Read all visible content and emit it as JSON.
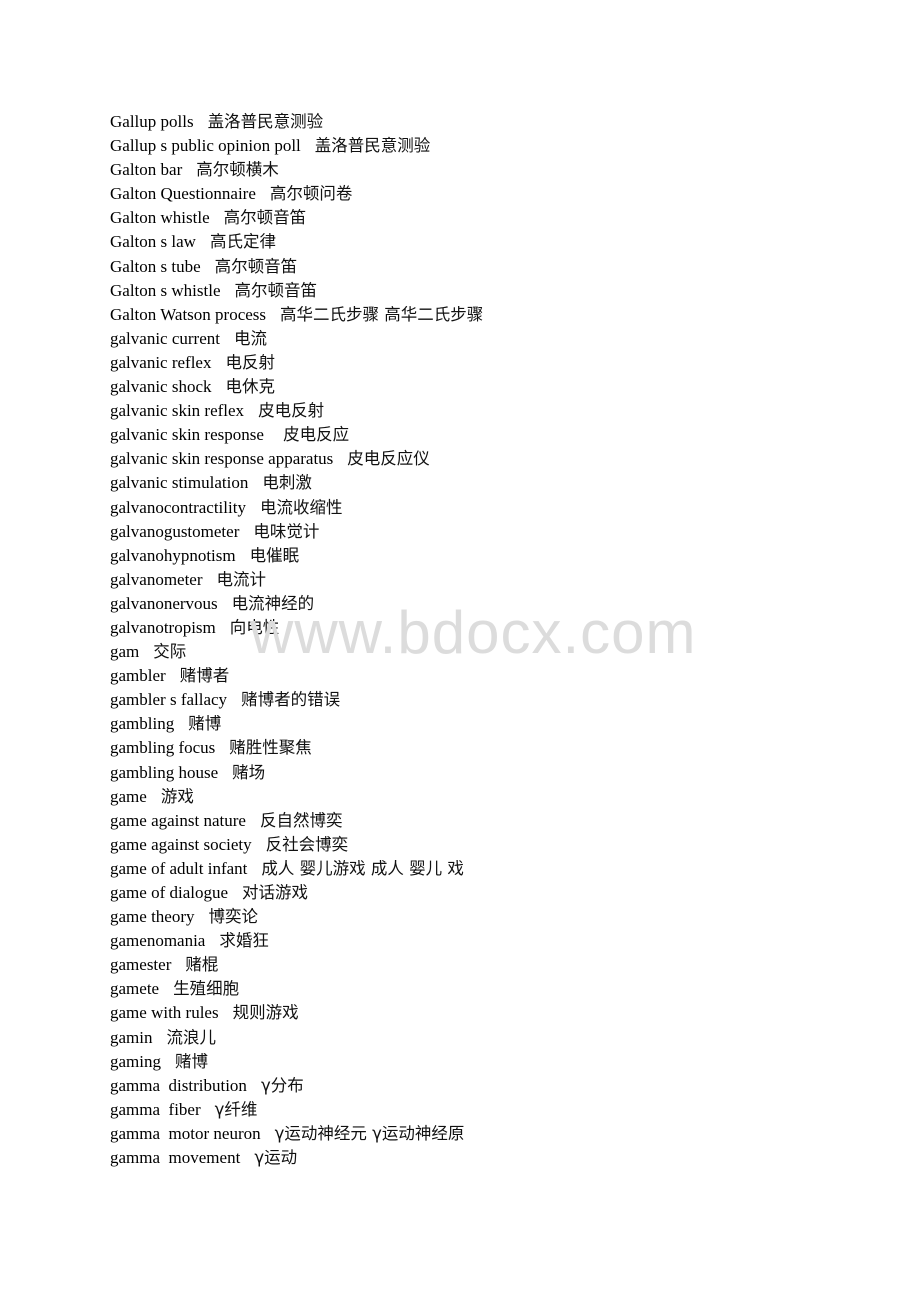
{
  "watermark": "www.bdocx.com",
  "entries": [
    {
      "term": "Gallup polls",
      "translation": "盖洛普民意测验"
    },
    {
      "term": "Gallup s public opinion poll",
      "translation": "盖洛普民意测验"
    },
    {
      "term": "Galton bar",
      "translation": "高尔顿横木"
    },
    {
      "term": "Galton Questionnaire",
      "translation": "高尔顿问卷"
    },
    {
      "term": "Galton whistle",
      "translation": "高尔顿音笛"
    },
    {
      "term": "Galton s law",
      "translation": "高氏定律"
    },
    {
      "term": "Galton s tube",
      "translation": "高尔顿音笛"
    },
    {
      "term": "Galton s whistle",
      "translation": "高尔顿音笛"
    },
    {
      "term": "Galton Watson process",
      "translation": "高华二氏步骤 高华二氏步骤"
    },
    {
      "term": "galvanic current",
      "translation": "电流"
    },
    {
      "term": "galvanic reflex",
      "translation": "电反射"
    },
    {
      "term": "galvanic shock",
      "translation": "电休克"
    },
    {
      "term": "galvanic skin reflex",
      "translation": "皮电反射"
    },
    {
      "term": "galvanic skin response",
      "translation": " 皮电反应"
    },
    {
      "term": "galvanic skin response apparatus",
      "translation": "皮电反应仪"
    },
    {
      "term": "galvanic stimulation",
      "translation": "电刺激"
    },
    {
      "term": "galvanocontractility",
      "translation": "电流收缩性"
    },
    {
      "term": "galvanogustometer",
      "translation": "电味觉计"
    },
    {
      "term": "galvanohypnotism",
      "translation": "电催眠"
    },
    {
      "term": "galvanometer",
      "translation": "电流计"
    },
    {
      "term": "galvanonervous",
      "translation": "电流神经的"
    },
    {
      "term": "galvanotropism",
      "translation": "向电性"
    },
    {
      "term": "gam",
      "translation": "交际"
    },
    {
      "term": "gambler",
      "translation": "赌博者"
    },
    {
      "term": "gambler s fallacy",
      "translation": "赌博者的错误"
    },
    {
      "term": "gambling",
      "translation": "赌博"
    },
    {
      "term": "gambling focus",
      "translation": "赌胜性聚焦"
    },
    {
      "term": "gambling house",
      "translation": "赌场"
    },
    {
      "term": "game",
      "translation": "游戏"
    },
    {
      "term": "game against nature",
      "translation": "反自然博奕"
    },
    {
      "term": "game against society",
      "translation": "反社会博奕"
    },
    {
      "term": "game of adult infant",
      "translation": "成人 婴儿游戏 成人 婴儿 戏"
    },
    {
      "term": "game of dialogue",
      "translation": "对话游戏"
    },
    {
      "term": "game theory",
      "translation": "博奕论"
    },
    {
      "term": "gamenomania",
      "translation": "求婚狂"
    },
    {
      "term": "gamester",
      "translation": "赌棍"
    },
    {
      "term": "gamete",
      "translation": "生殖细胞"
    },
    {
      "term": "game with rules",
      "translation": "规则游戏"
    },
    {
      "term": "gamin",
      "translation": "流浪儿"
    },
    {
      "term": "gaming",
      "translation": "赌博"
    },
    {
      "term": "gamma  distribution",
      "translation": "γ分布"
    },
    {
      "term": "gamma  fiber",
      "translation": "γ纤维"
    },
    {
      "term": "gamma  motor neuron",
      "translation": "γ运动神经元 γ运动神经原"
    },
    {
      "term": "gamma  movement",
      "translation": "γ运动"
    }
  ]
}
